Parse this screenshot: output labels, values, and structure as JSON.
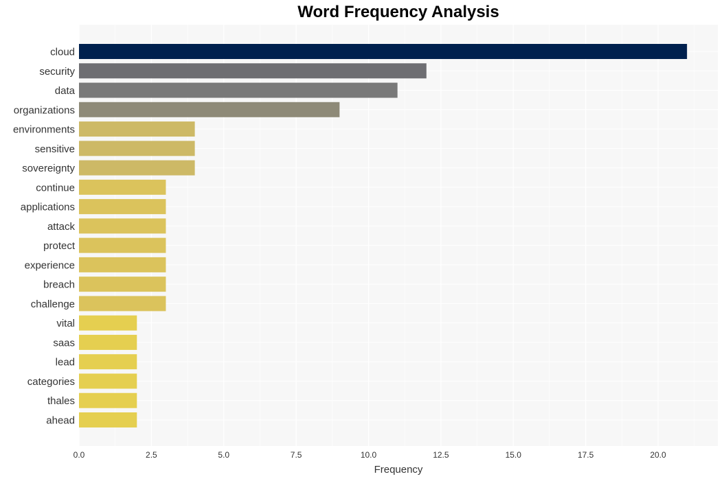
{
  "chart_data": {
    "type": "bar",
    "orientation": "horizontal",
    "title": "Word Frequency Analysis",
    "xlabel": "Frequency",
    "ylabel": "",
    "xlim": [
      0,
      22
    ],
    "xticks": [
      0,
      2.5,
      5,
      7.5,
      10,
      12.5,
      15,
      17.5,
      20
    ],
    "xtick_labels": [
      "0.0",
      "2.5",
      "5.0",
      "7.5",
      "10.0",
      "12.5",
      "15.0",
      "17.5",
      "20.0"
    ],
    "grid": true,
    "categories": [
      "cloud",
      "security",
      "data",
      "organizations",
      "environments",
      "sensitive",
      "sovereignty",
      "continue",
      "applications",
      "attack",
      "protect",
      "experience",
      "breach",
      "challenge",
      "vital",
      "saas",
      "lead",
      "categories",
      "thales",
      "ahead"
    ],
    "values": [
      21,
      12,
      11,
      9,
      4,
      4,
      4,
      3,
      3,
      3,
      3,
      3,
      3,
      3,
      2,
      2,
      2,
      2,
      2,
      2
    ],
    "colors": [
      "#00204e",
      "#6e6e72",
      "#797979",
      "#8e8a78",
      "#cdb966",
      "#cdb966",
      "#cdb966",
      "#dbc35c",
      "#dbc35c",
      "#dbc35c",
      "#dbc35c",
      "#dbc35c",
      "#dbc35c",
      "#dbc35c",
      "#e5cf50",
      "#e5cf50",
      "#e5cf50",
      "#e5cf50",
      "#e5cf50",
      "#e5cf50"
    ],
    "background": "#f7f7f7",
    "gridline_color": "#ffffff"
  }
}
